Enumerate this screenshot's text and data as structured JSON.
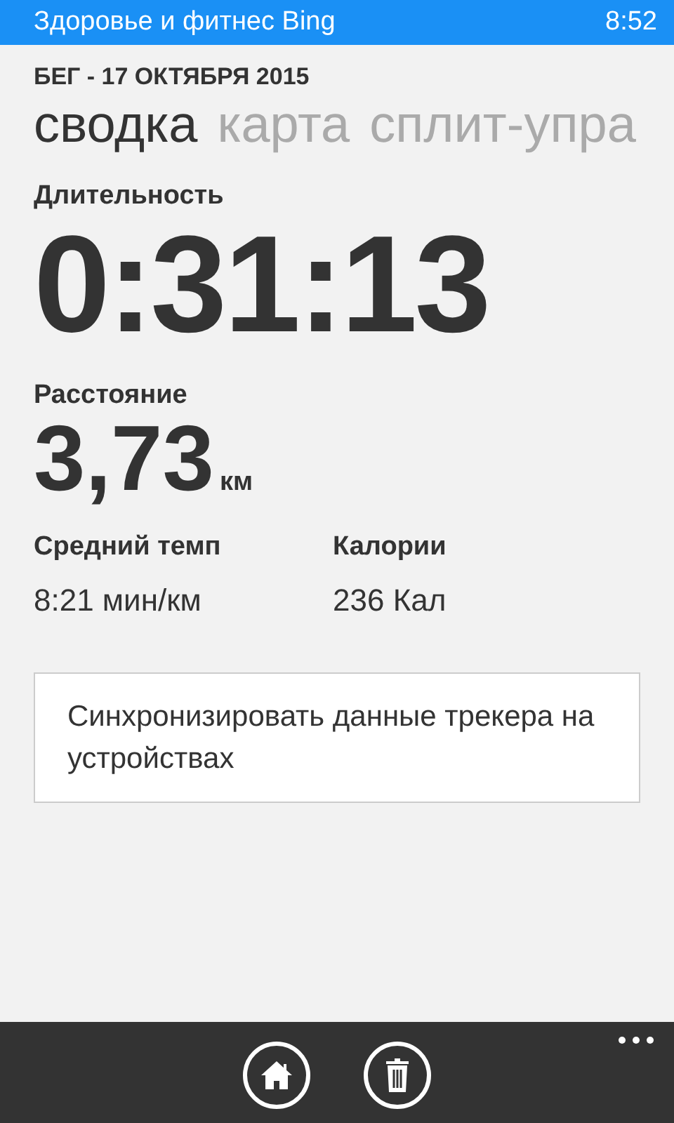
{
  "status_bar": {
    "app_title": "Здоровье и фитнес Bing",
    "time": "8:52"
  },
  "header": "БЕГ - 17 ОКТЯБРЯ 2015",
  "tabs": [
    {
      "label": "сводка",
      "selected": true
    },
    {
      "label": "карта",
      "selected": false
    },
    {
      "label": "сплит-упра",
      "selected": false
    }
  ],
  "duration": {
    "label": "Длительность",
    "value": "0:31:13"
  },
  "distance": {
    "label": "Расстояние",
    "value": "3,73",
    "unit": "км"
  },
  "stats": [
    {
      "label": "Средний темп",
      "value": "8:21 мин/км"
    },
    {
      "label": "Калории",
      "value": "236 Кал"
    }
  ],
  "sync_button": {
    "label": "Синхронизировать данные трекера на устройствах"
  },
  "app_bar": {
    "buttons": [
      {
        "kind": "home"
      },
      {
        "kind": "delete"
      }
    ]
  }
}
